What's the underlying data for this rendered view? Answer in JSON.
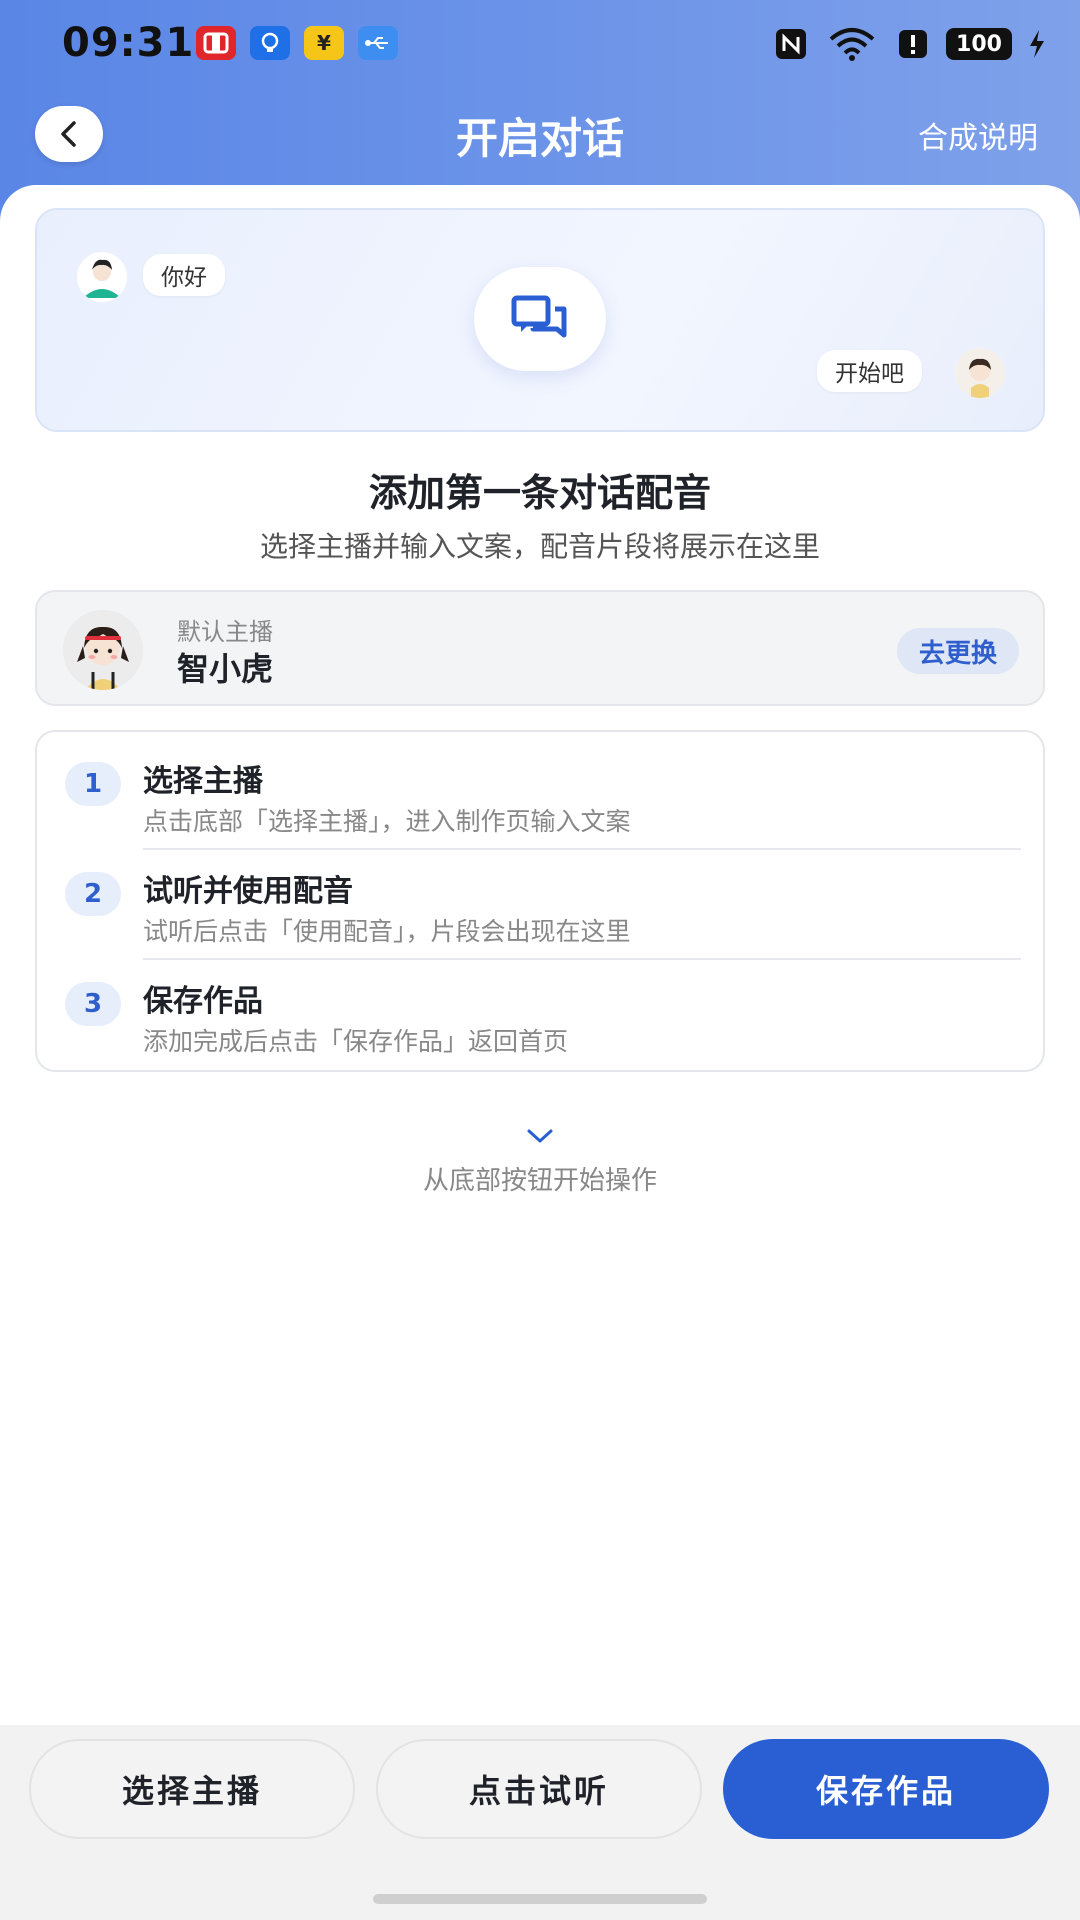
{
  "status_bar": {
    "time": "09:31",
    "battery": "100",
    "app_icons": [
      "red-square-icon",
      "blue-bulb-icon",
      "yen-icon",
      "usb-icon"
    ],
    "right_icons": [
      "nfc-icon",
      "wifi-icon",
      "alert-icon",
      "battery-icon",
      "charging-icon"
    ]
  },
  "nav": {
    "title": "开启对话",
    "action": "合成说明"
  },
  "hero": {
    "bubble_left": "你好",
    "bubble_right": "开始吧"
  },
  "headline": "添加第一条对话配音",
  "subline": "选择主播并输入文案，配音片段将展示在这里",
  "anchor": {
    "label": "默认主播",
    "name": "智小虎",
    "change_label": "去更换"
  },
  "steps": [
    {
      "num": "1",
      "title": "选择主播",
      "desc": "点击底部「选择主播」，进入制作页输入文案"
    },
    {
      "num": "2",
      "title": "试听并使用配音",
      "desc": "试听后点击「使用配音」，片段会出现在这里"
    },
    {
      "num": "3",
      "title": "保存作品",
      "desc": "添加完成后点击「保存作品」返回首页"
    }
  ],
  "hint": "从底部按钮开始操作",
  "bottom": {
    "select_anchor": "选择主播",
    "preview": "点击试听",
    "save": "保存作品"
  },
  "colors": {
    "accent": "#2a5fd3",
    "header_gradient_start": "#5a86e6",
    "header_gradient_end": "#7fa1ea"
  }
}
